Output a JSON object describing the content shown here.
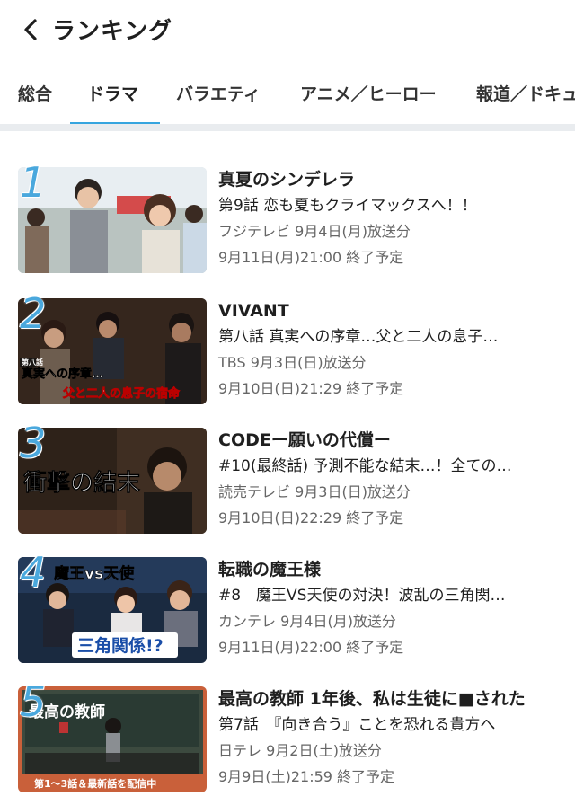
{
  "header": {
    "title": "ランキング",
    "back_icon": "chevron-left-icon"
  },
  "tabs": [
    {
      "label": "総合"
    },
    {
      "label": "ドラマ",
      "active": true
    },
    {
      "label": "バラエティ"
    },
    {
      "label": "アニメ／ヒーロー"
    },
    {
      "label": "報道／ドキュ"
    }
  ],
  "colors": {
    "accent": "#36a5df",
    "rank": "#4aa8dd"
  },
  "ranking": [
    {
      "rank": "1",
      "title": "真夏のシンデレラ",
      "episode": "第9話 恋も夏もクライマックスへ！！",
      "broadcast": "フジテレビ 9月4日(月)放送分",
      "ends": "9月11日(月)21:00 終了予定"
    },
    {
      "rank": "2",
      "title": "VIVANT",
      "episode": "第八話 真実への序章…父と二人の息子…",
      "broadcast": "TBS 9月3日(日)放送分",
      "ends": "9月10日(日)21:29 終了予定",
      "thumb_text": [
        "第八話",
        "真実への序章…",
        "父と二人の息子の宿命"
      ]
    },
    {
      "rank": "3",
      "title": "CODEー願いの代償ー",
      "episode": "#10(最終話) 予測不能な結末…！全ての…",
      "broadcast": "読売テレビ 9月3日(日)放送分",
      "ends": "9月10日(日)22:29 終了予定",
      "thumb_text": [
        "衝撃の結末"
      ]
    },
    {
      "rank": "4",
      "title": "転職の魔王様",
      "episode": "#8　魔王VS天使の対決！波乱の三角関…",
      "broadcast": "カンテレ 9月4日(月)放送分",
      "ends": "9月11日(月)22:00 終了予定",
      "thumb_text": [
        "魔王vs天使",
        "三角関係!?"
      ]
    },
    {
      "rank": "5",
      "title": "最高の教師 1年後、私は生徒に■された",
      "episode": "第7話　『向き合う』ことを恐れる貴方へ",
      "broadcast": "日テレ 9月2日(土)放送分",
      "ends": "9月9日(土)21:59 終了予定",
      "thumb_text": [
        "最高の教師",
        "第1〜3話＆最新話を配信中"
      ]
    }
  ]
}
